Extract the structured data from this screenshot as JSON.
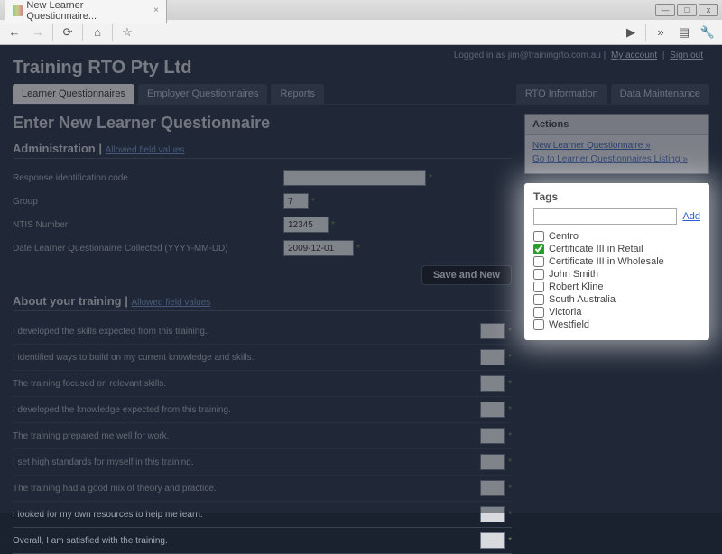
{
  "browser": {
    "tab_title": "New Learner Questionnaire..."
  },
  "header": {
    "site_title": "Training RTO Pty Ltd",
    "logged_in_prefix": "Logged in as ",
    "logged_in_user": "jim@trainingrto.com.au",
    "my_account": "My account",
    "sign_out": "Sign out"
  },
  "nav": {
    "tabs": [
      {
        "label": "Learner Questionnaires",
        "active": true
      },
      {
        "label": "Employer Questionnaires",
        "active": false
      },
      {
        "label": "Reports",
        "active": false
      }
    ],
    "right": [
      {
        "label": "RTO Information"
      },
      {
        "label": "Data Maintenance"
      }
    ]
  },
  "page": {
    "title": "Enter New Learner Questionnaire",
    "admin_section": "Administration",
    "allowed_link": "Allowed field values",
    "admin_fields": {
      "response_code_label": "Response identification code",
      "response_code_value": "",
      "group_label": "Group",
      "group_value": "7",
      "ntis_label": "NTIS Number",
      "ntis_value": "12345",
      "date_label": "Date Learner Questionairre Collected (YYYY-MM-DD)",
      "date_value": "2009-12-01"
    },
    "save_btn": "Save and New",
    "training_section": "About your training",
    "training_items": [
      "I developed the skills expected from this training.",
      "I identified ways to build on my current knowledge and skills.",
      "The training focused on relevant skills.",
      "I developed the knowledge expected from this training.",
      "The training prepared me well for work.",
      "I set high standards for myself in this training.",
      "The training had a good mix of theory and practice.",
      "I looked for my own resources to help me learn.",
      "Overall, I am satisfied with the training."
    ]
  },
  "sidebar": {
    "actions_title": "Actions",
    "actions_links": [
      "New Learner Questionnaire »",
      "Go to Learner Questionnaires Listing »"
    ],
    "tags_title": "Tags",
    "tags_add": "Add",
    "tags": [
      {
        "label": "Centro",
        "checked": false
      },
      {
        "label": "Certificate III in Retail",
        "checked": true
      },
      {
        "label": "Certificate III in Wholesale",
        "checked": false
      },
      {
        "label": "John Smith",
        "checked": false
      },
      {
        "label": "Robert Kline",
        "checked": false
      },
      {
        "label": "South Australia",
        "checked": false
      },
      {
        "label": "Victoria",
        "checked": false
      },
      {
        "label": "Westfield",
        "checked": false
      }
    ]
  }
}
